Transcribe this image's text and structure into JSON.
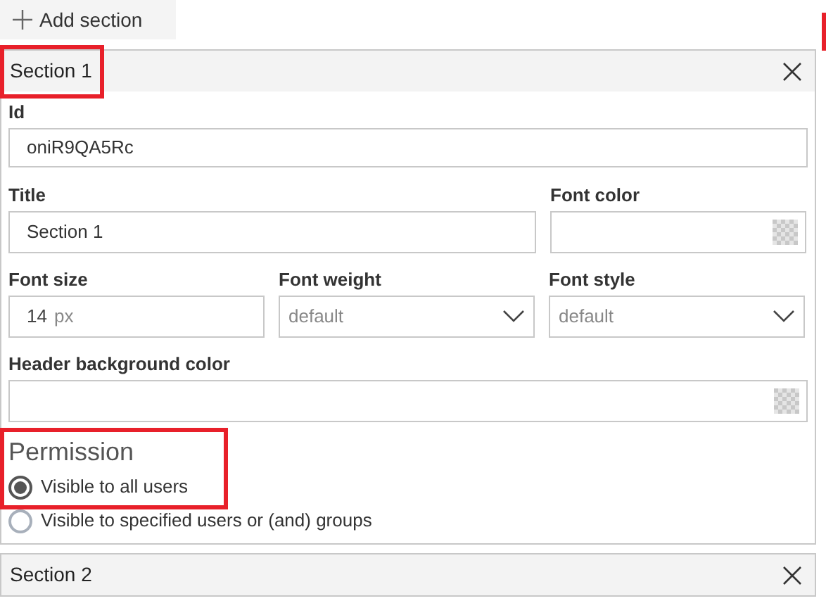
{
  "add_button": {
    "label": "Add section"
  },
  "sections": [
    {
      "title": "Section 1",
      "expanded": true,
      "highlighted": true,
      "form": {
        "id": {
          "label": "Id",
          "value": "oniR9QA5Rc"
        },
        "title": {
          "label": "Title",
          "value": "Section 1"
        },
        "font_color": {
          "label": "Font color"
        },
        "font_size": {
          "label": "Font size",
          "value": "14",
          "unit": "px"
        },
        "font_weight": {
          "label": "Font weight",
          "value": "default"
        },
        "font_style": {
          "label": "Font style",
          "value": "default"
        },
        "header_bg": {
          "label": "Header background color"
        },
        "permission": {
          "heading": "Permission",
          "highlighted": true,
          "options": [
            {
              "label": "Visible to all users",
              "selected": true
            },
            {
              "label": "Visible to specified users or (and) groups",
              "selected": false
            }
          ]
        }
      }
    },
    {
      "title": "Section 2",
      "expanded": false,
      "highlighted": false
    }
  ]
}
